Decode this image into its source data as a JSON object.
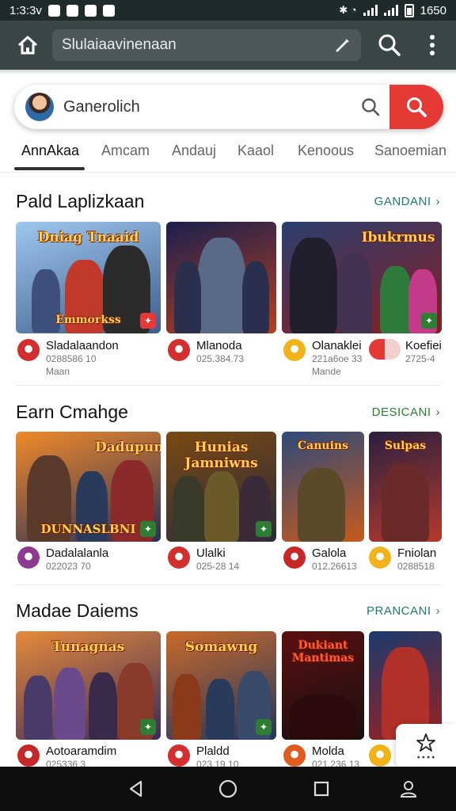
{
  "status_bar": {
    "time": "1:3:3v",
    "right_text": "1650"
  },
  "browser": {
    "url": "Slulaiaavinenaan"
  },
  "search": {
    "text": "Ganerolich"
  },
  "tabs": [
    {
      "label": "AnnAkaa"
    },
    {
      "label": "Amcam"
    },
    {
      "label": "Andauj"
    },
    {
      "label": "Kaaol"
    },
    {
      "label": "Kenoous"
    },
    {
      "label": "Sanoemian"
    }
  ],
  "sections": [
    {
      "title": "Pald Laplizkaan",
      "link": "GANDANI",
      "link_color": "#1e7a6e",
      "cards": [
        {
          "art_title": "Dniag Tnaaid",
          "art_sub": "Emmorkss",
          "name": "Sladalaandon",
          "sub": "0288586 10",
          "sub2": "Maan",
          "icon_color": "#d32f2f",
          "palette": [
            "#9ec8ee",
            "#3f5d8c"
          ]
        },
        {
          "art_title": "",
          "art_sub": "",
          "name": "Mlanoda",
          "sub": "025.384.73",
          "sub2": "",
          "icon_color": "#d32f2f",
          "palette": [
            "#1b1f4d",
            "#b5401f"
          ]
        },
        {
          "art_title": "Ibukrmus",
          "art_sub": "",
          "name": "Olanaklei",
          "sub": "221a6oe 33",
          "sub2": "Mande",
          "icon_color": "#f2b31a",
          "palette": [
            "#2a3f6e",
            "#8a1d22"
          ]
        },
        {
          "art_title": "",
          "art_sub": "",
          "name": "Koefiei",
          "sub": "2725-4",
          "sub2": "",
          "icon_color": "#e53935",
          "palette": []
        }
      ]
    },
    {
      "title": "Earn Cmahge",
      "link": "DESICANI",
      "link_color": "#2e7d32",
      "cards": [
        {
          "art_title": "Dadupuns",
          "art_sub": "DUNNASLBNI",
          "name": "Dadalalanla",
          "sub": "022023 70",
          "sub2": "",
          "icon_color": "#8e3b8f",
          "palette": [
            "#f08a2a",
            "#2a2f56"
          ]
        },
        {
          "art_title": "Hunias Jamniwns",
          "art_sub": "",
          "name": "Ulalki",
          "sub": "025-28 14",
          "sub2": "",
          "icon_color": "#d32f2f",
          "palette": [
            "#7a4a12",
            "#2a2a3a"
          ]
        },
        {
          "art_title": "Canuins",
          "art_sub": "",
          "name": "Galola",
          "sub": "012.26613",
          "sub2": "",
          "icon_color": "#c62828",
          "palette": [
            "#2d4a7a",
            "#c75a1e"
          ]
        },
        {
          "art_title": "Sulpas",
          "art_sub": "",
          "name": "Fniolan",
          "sub": "0288518",
          "sub2": "",
          "icon_color": "#f2b31a",
          "palette": [
            "#2a2040",
            "#b53a2a"
          ]
        }
      ]
    },
    {
      "title": "Madae Daiems",
      "link": "PRANCANI",
      "link_color": "#1e7a6e",
      "cards": [
        {
          "art_title": "Tunagnas",
          "art_sub": "",
          "name": "Aotoaramdim",
          "sub": "025336 3",
          "sub2": "",
          "icon_color": "#c62828",
          "palette": [
            "#e58a3a",
            "#3a2a5a"
          ]
        },
        {
          "art_title": "Somawng",
          "art_sub": "",
          "name": "Plaldd",
          "sub": "023 19 10",
          "sub2": "",
          "icon_color": "#d32f2f",
          "palette": [
            "#c96a2a",
            "#23355e"
          ]
        },
        {
          "art_title": "Dukiant Mantimas",
          "art_sub": "",
          "name": "Molda",
          "sub": "021.236 13",
          "sub2": "",
          "icon_color": "#e05b20",
          "palette": [
            "#5a1010",
            "#1a1010"
          ]
        },
        {
          "art_title": "",
          "art_sub": "",
          "name": "",
          "sub": "",
          "sub2": "",
          "icon_color": "#f2b31a",
          "palette": [
            "#1b3b6e",
            "#9a2020"
          ]
        }
      ]
    }
  ],
  "colors": {
    "accent_red": "#e53935",
    "appbar": "#3a4646"
  },
  "icons": [
    "home-icon",
    "edit-icon",
    "search-icon",
    "more-vert-icon",
    "star-icon",
    "back-icon",
    "home-circle-icon",
    "recents-icon",
    "account-icon"
  ]
}
